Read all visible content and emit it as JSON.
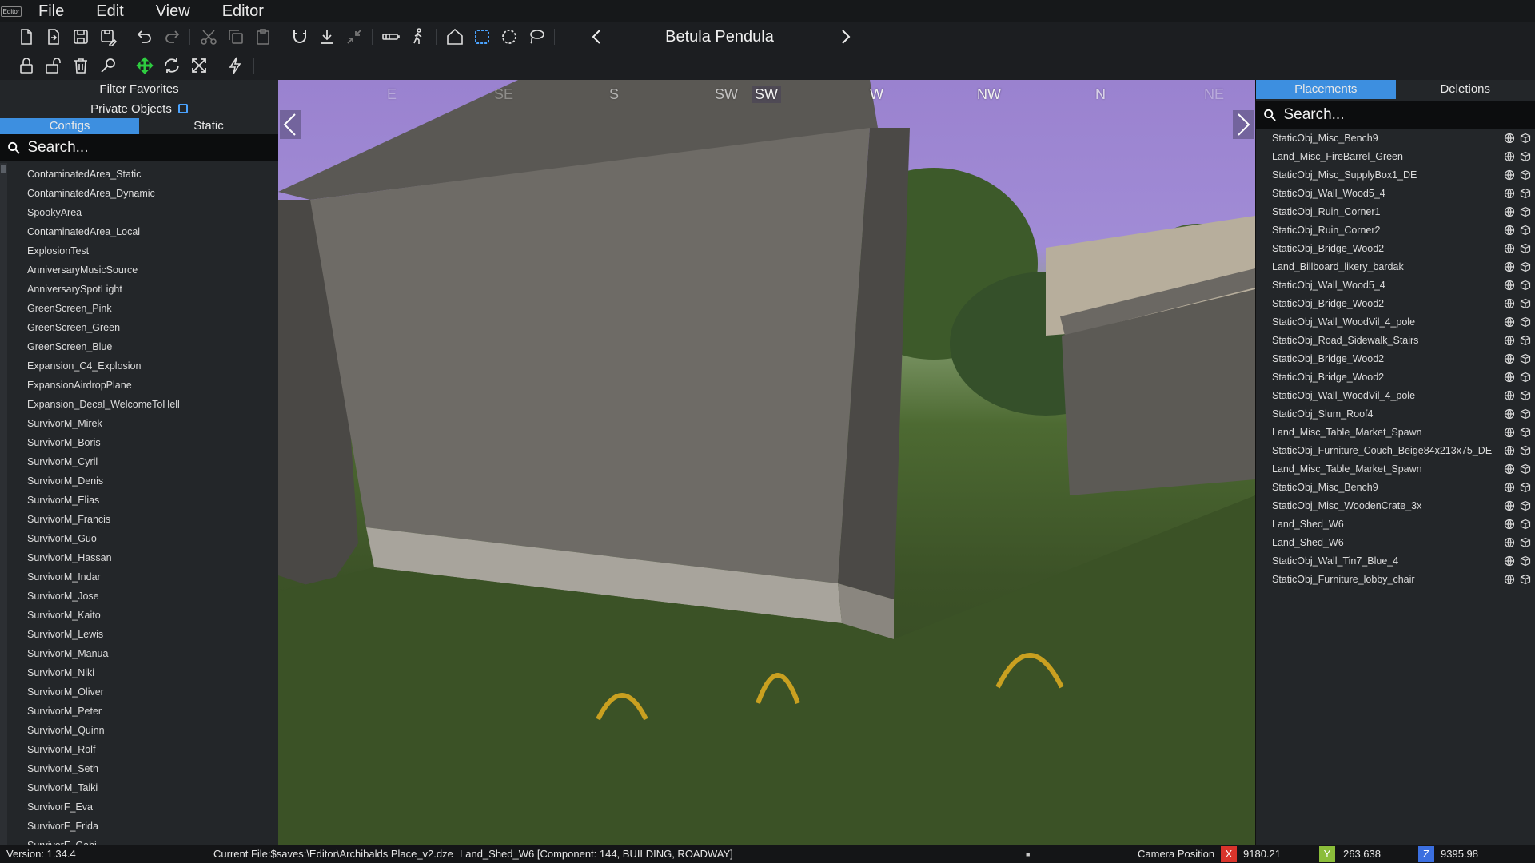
{
  "app": {
    "logo_text": "Editor"
  },
  "menu": [
    "File",
    "Edit",
    "View",
    "Editor"
  ],
  "toolbar": {
    "brush_title": "Betula Pendula",
    "row1_icons": [
      "new-file-icon",
      "open-file-icon",
      "save-icon",
      "save-as-icon",
      "undo-icon",
      "redo-icon",
      "cut-icon",
      "copy-icon",
      "paste-icon",
      "magnet-icon",
      "ground-snap-icon",
      "collapse-icon",
      "camera-track-icon",
      "walk-icon",
      "home-icon",
      "box-select-icon",
      "circle-select-icon",
      "lasso-select-icon"
    ],
    "row2_icons": [
      "lock-icon",
      "unlock-icon",
      "delete-icon",
      "search-key-icon",
      "move-icon",
      "rotate-icon",
      "scale-icon",
      "lightning-icon"
    ]
  },
  "left_panel": {
    "filter_favorites": "Filter Favorites",
    "private_objects": "Private Objects",
    "tabs": [
      {
        "label": "Configs",
        "active": true
      },
      {
        "label": "Static",
        "active": false
      }
    ],
    "search_placeholder": "Search...",
    "items": [
      "ContaminatedArea_Static",
      "ContaminatedArea_Dynamic",
      "SpookyArea",
      "ContaminatedArea_Local",
      "ExplosionTest",
      "AnniversaryMusicSource",
      "AnniversarySpotLight",
      "GreenScreen_Pink",
      "GreenScreen_Green",
      "GreenScreen_Blue",
      "Expansion_C4_Explosion",
      "ExpansionAirdropPlane",
      "Expansion_Decal_WelcomeToHell",
      "SurvivorM_Mirek",
      "SurvivorM_Boris",
      "SurvivorM_Cyril",
      "SurvivorM_Denis",
      "SurvivorM_Elias",
      "SurvivorM_Francis",
      "SurvivorM_Guo",
      "SurvivorM_Hassan",
      "SurvivorM_Indar",
      "SurvivorM_Jose",
      "SurvivorM_Kaito",
      "SurvivorM_Lewis",
      "SurvivorM_Manua",
      "SurvivorM_Niki",
      "SurvivorM_Oliver",
      "SurvivorM_Peter",
      "SurvivorM_Quinn",
      "SurvivorM_Rolf",
      "SurvivorM_Seth",
      "SurvivorM_Taiki",
      "SurvivorF_Eva",
      "SurvivorF_Frida",
      "SurvivorF_Gabi"
    ]
  },
  "viewport": {
    "compass": [
      "E",
      "SE",
      "S",
      "SW",
      "SW",
      "W",
      "NW",
      "N",
      "NE"
    ]
  },
  "right_panel": {
    "tabs": [
      {
        "label": "Placements",
        "active": true
      },
      {
        "label": "Deletions",
        "active": false
      }
    ],
    "search_placeholder": "Search...",
    "items": [
      "StaticObj_Misc_Bench9",
      "Land_Misc_FireBarrel_Green",
      "StaticObj_Misc_SupplyBox1_DE",
      "StaticObj_Wall_Wood5_4",
      "StaticObj_Ruin_Corner1",
      "StaticObj_Ruin_Corner2",
      "StaticObj_Bridge_Wood2",
      "Land_Billboard_likery_bardak",
      "StaticObj_Wall_Wood5_4",
      "StaticObj_Bridge_Wood2",
      "StaticObj_Wall_WoodVil_4_pole",
      "StaticObj_Road_Sidewalk_Stairs",
      "StaticObj_Bridge_Wood2",
      "StaticObj_Bridge_Wood2",
      "StaticObj_Wall_WoodVil_4_pole",
      "StaticObj_Slum_Roof4",
      "Land_Misc_Table_Market_Spawn",
      "StaticObj_Furniture_Couch_Beige84x213x75_DE",
      "Land_Misc_Table_Market_Spawn",
      "StaticObj_Misc_Bench9",
      "StaticObj_Misc_WoodenCrate_3x",
      "Land_Shed_W6",
      "Land_Shed_W6",
      "StaticObj_Wall_Tin7_Blue_4",
      "StaticObj_Furniture_lobby_chair"
    ]
  },
  "status": {
    "version": "Version: 1.34.4",
    "current_file": "Current File:$saves:\\Editor\\Archibalds Place_v2.dze",
    "selection": "Land_Shed_W6 [Component: 144, BUILDING, ROADWAY]",
    "camera_label": "Camera Position",
    "x_label": "X",
    "x_value": "9180.21",
    "y_label": "Y",
    "y_value": "263.638",
    "z_label": "Z",
    "z_value": "9395.98"
  },
  "colors": {
    "accent": "#3d8fe0",
    "x_badge": "#d9342b",
    "y_badge": "#8bbd3a",
    "z_badge": "#3b6fe0",
    "move_active": "#2ecc40"
  }
}
